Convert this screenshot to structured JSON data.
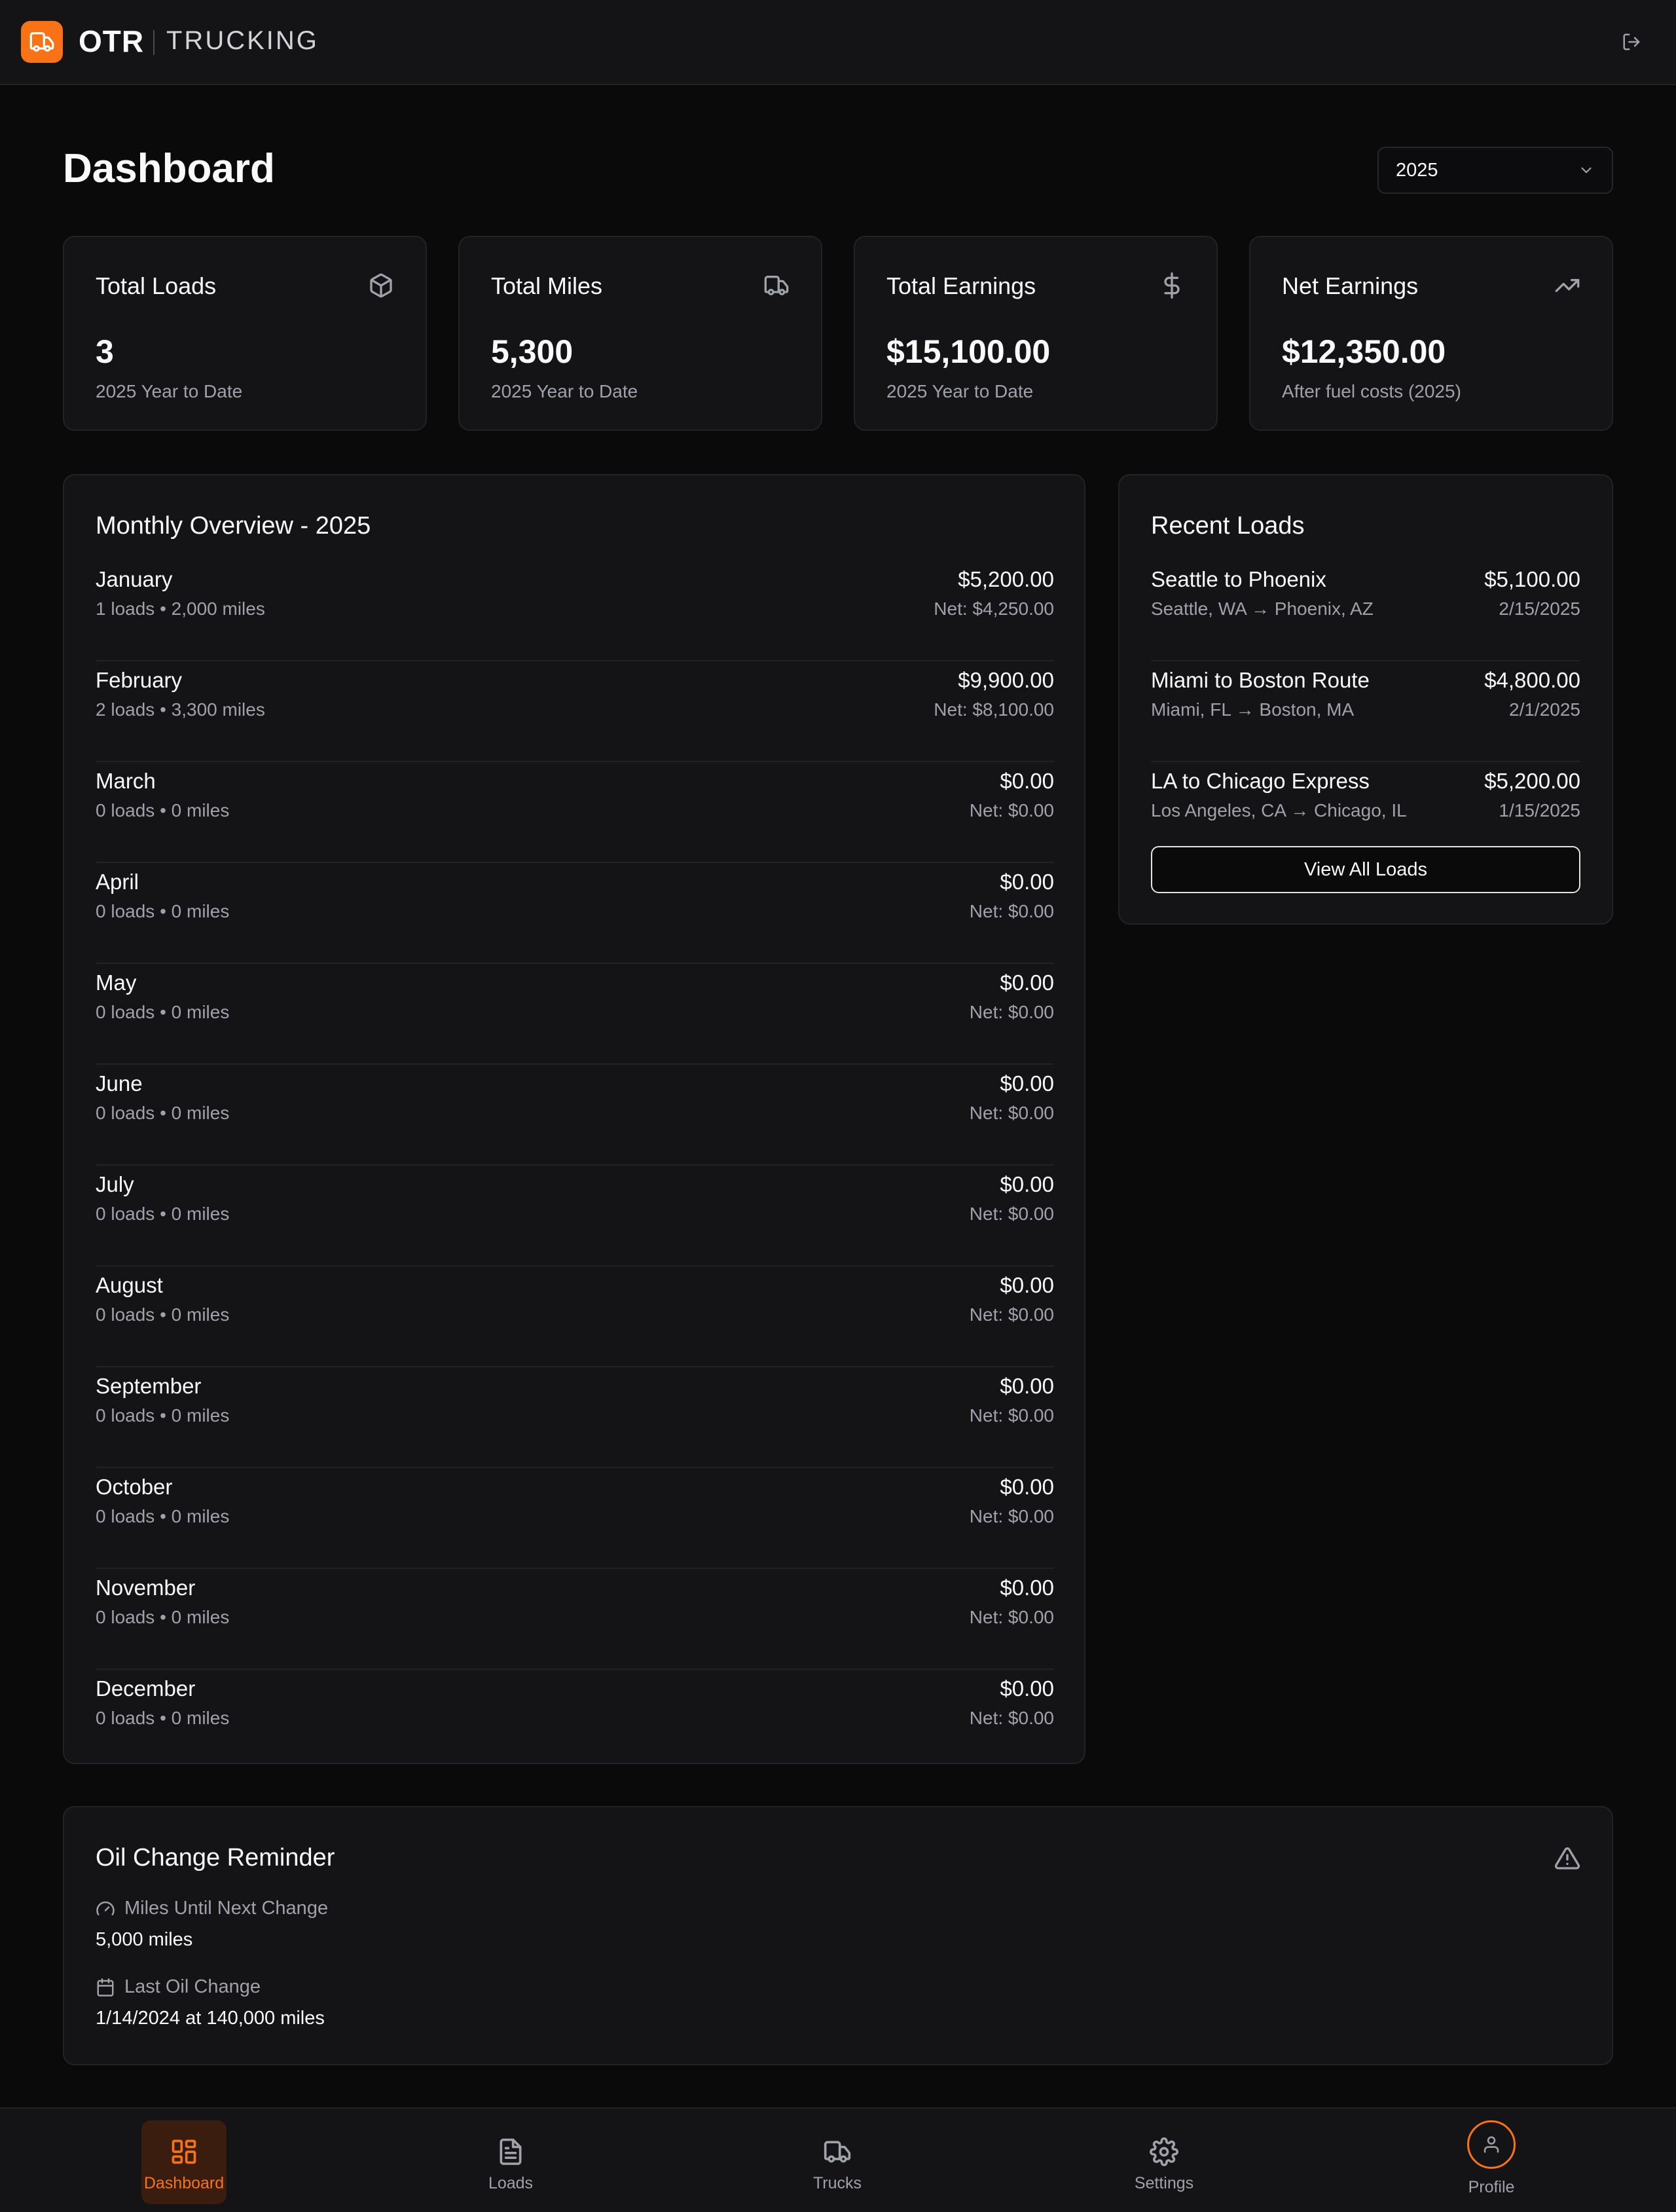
{
  "app": {
    "brand_main": "OTR",
    "brand_sub": "TRUCKING",
    "accent_color": "#f97316",
    "logo_icon": "truck-icon",
    "logout_icon": "logout-icon"
  },
  "page": {
    "title": "Dashboard",
    "year_selected": "2025"
  },
  "stats": [
    {
      "title": "Total Loads",
      "value": "3",
      "sub": "2025 Year to Date",
      "icon": "package-icon"
    },
    {
      "title": "Total Miles",
      "value": "5,300",
      "sub": "2025 Year to Date",
      "icon": "truck-icon"
    },
    {
      "title": "Total Earnings",
      "value": "$15,100.00",
      "sub": "2025 Year to Date",
      "icon": "dollar-icon"
    },
    {
      "title": "Net Earnings",
      "value": "$12,350.00",
      "sub": "After fuel costs (2025)",
      "icon": "trending-up-icon"
    }
  ],
  "monthly": {
    "title": "Monthly Overview - 2025",
    "rows": [
      {
        "month": "January",
        "stats": "1 loads • 2,000 miles",
        "gross": "$5,200.00",
        "net": "Net: $4,250.00"
      },
      {
        "month": "February",
        "stats": "2 loads • 3,300 miles",
        "gross": "$9,900.00",
        "net": "Net: $8,100.00"
      },
      {
        "month": "March",
        "stats": "0 loads • 0 miles",
        "gross": "$0.00",
        "net": "Net: $0.00"
      },
      {
        "month": "April",
        "stats": "0 loads • 0 miles",
        "gross": "$0.00",
        "net": "Net: $0.00"
      },
      {
        "month": "May",
        "stats": "0 loads • 0 miles",
        "gross": "$0.00",
        "net": "Net: $0.00"
      },
      {
        "month": "June",
        "stats": "0 loads • 0 miles",
        "gross": "$0.00",
        "net": "Net: $0.00"
      },
      {
        "month": "July",
        "stats": "0 loads • 0 miles",
        "gross": "$0.00",
        "net": "Net: $0.00"
      },
      {
        "month": "August",
        "stats": "0 loads • 0 miles",
        "gross": "$0.00",
        "net": "Net: $0.00"
      },
      {
        "month": "September",
        "stats": "0 loads • 0 miles",
        "gross": "$0.00",
        "net": "Net: $0.00"
      },
      {
        "month": "October",
        "stats": "0 loads • 0 miles",
        "gross": "$0.00",
        "net": "Net: $0.00"
      },
      {
        "month": "November",
        "stats": "0 loads • 0 miles",
        "gross": "$0.00",
        "net": "Net: $0.00"
      },
      {
        "month": "December",
        "stats": "0 loads • 0 miles",
        "gross": "$0.00",
        "net": "Net: $0.00"
      }
    ]
  },
  "recent_loads": {
    "title": "Recent Loads",
    "items": [
      {
        "name": "Seattle to Phoenix",
        "route": "Seattle, WA → Phoenix, AZ",
        "amount": "$5,100.00",
        "date": "2/15/2025"
      },
      {
        "name": "Miami to Boston Route",
        "route": "Miami, FL → Boston, MA",
        "amount": "$4,800.00",
        "date": "2/1/2025"
      },
      {
        "name": "LA to Chicago Express",
        "route": "Los Angeles, CA → Chicago, IL",
        "amount": "$5,200.00",
        "date": "1/15/2025"
      }
    ],
    "view_all_label": "View All Loads"
  },
  "oil_change": {
    "title": "Oil Change Reminder",
    "miles_label": "Miles Until Next Change",
    "miles_value": "5,000 miles",
    "last_label": "Last Oil Change",
    "last_value": "1/14/2024 at 140,000 miles",
    "icons": {
      "alert": "alert-triangle-icon",
      "miles": "gauge-icon",
      "last": "calendar-icon"
    }
  },
  "nav": [
    {
      "label": "Dashboard",
      "icon": "dashboard-icon",
      "active": true
    },
    {
      "label": "Loads",
      "icon": "document-icon",
      "active": false
    },
    {
      "label": "Trucks",
      "icon": "truck-icon",
      "active": false
    },
    {
      "label": "Settings",
      "icon": "gear-icon",
      "active": false
    },
    {
      "label": "Profile",
      "icon": "user-icon",
      "active": false
    }
  ]
}
